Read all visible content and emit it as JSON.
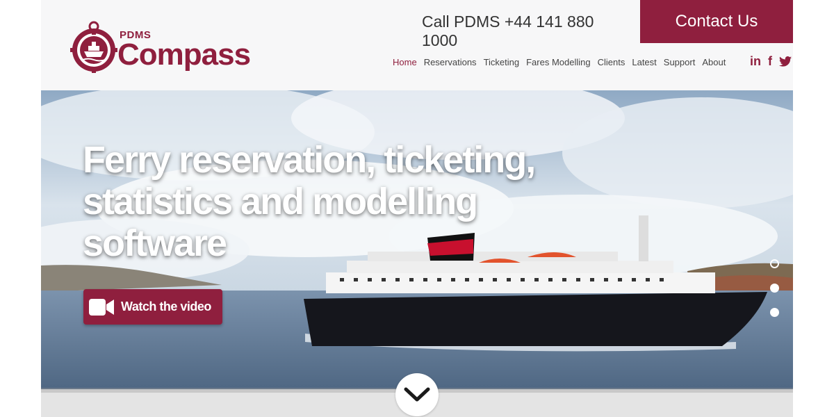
{
  "brand": {
    "small": "PDMS",
    "name": "Compass",
    "color": "#8f1f3e"
  },
  "header": {
    "phone": "Call PDMS +44 141 880 1000",
    "contact_label": "Contact Us"
  },
  "nav": {
    "items": [
      {
        "label": "Home",
        "active": true
      },
      {
        "label": "Reservations"
      },
      {
        "label": "Ticketing"
      },
      {
        "label": "Fares Modelling"
      },
      {
        "label": "Clients"
      },
      {
        "label": "Latest"
      },
      {
        "label": "Support"
      },
      {
        "label": "About"
      }
    ]
  },
  "social": {
    "linkedin": "in",
    "facebook": "f",
    "twitter": "twitter-icon"
  },
  "hero": {
    "title_line1": "Ferry reservation, ticketing,",
    "title_line2": "statistics and modelling",
    "title_line3": "software",
    "watch_label": "Watch the video",
    "slides": 3,
    "active_slide": 1
  }
}
